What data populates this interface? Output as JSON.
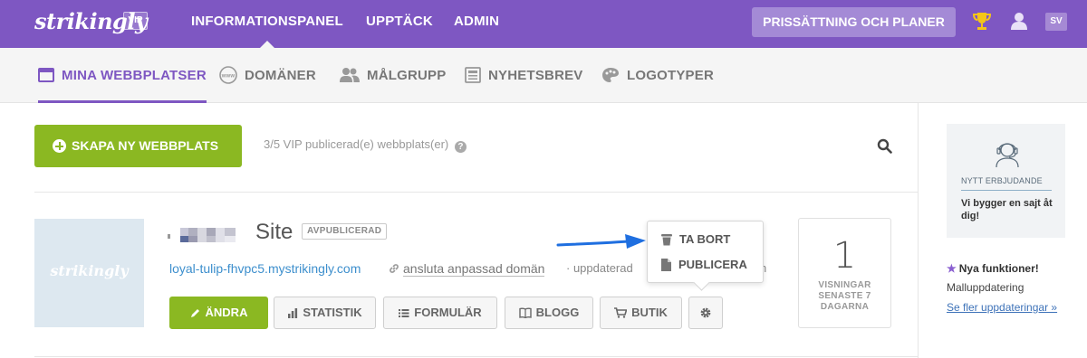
{
  "topbar": {
    "logo": "strikingly",
    "vip_badge": "VIP",
    "nav": [
      "INFORMATIONSPANEL",
      "UPPTÄCK",
      "ADMIN"
    ],
    "pricing_button": "PRISSÄTTNING OCH PLANER",
    "language": "SV",
    "icons": [
      "trophy-icon",
      "user-icon"
    ]
  },
  "subnav": {
    "items": [
      {
        "label": "MINA WEBBPLATSER",
        "icon": "browser-window-icon"
      },
      {
        "label": "DOMÄNER",
        "icon": "www-icon"
      },
      {
        "label": "MÅLGRUPP",
        "icon": "users-icon"
      },
      {
        "label": "NYHETSBREV",
        "icon": "newsletter-icon"
      },
      {
        "label": "LOGOTYPER",
        "icon": "palette-icon"
      }
    ]
  },
  "toolbar": {
    "create_label": "SKAPA NY WEBBPLATS",
    "vip_count": "3/5 VIP publicerad(e) webbplats(er)",
    "help": "?"
  },
  "site": {
    "thumb_logo": "strikingly",
    "name": "Site",
    "status": "AVPUBLICERAD",
    "url": "loyal-tulip-fhvpc5.mystrikingly.com",
    "connect_domain": "ansluta anpassad domän",
    "updated": "· uppdaterad",
    "updated_tail": "h",
    "buttons": {
      "edit": "ÄNDRA",
      "stats": "STATISTIK",
      "forms": "FORMULÄR",
      "blog": "BLOGG",
      "store": "BUTIK"
    },
    "menu": {
      "delete": "TA BORT",
      "publish": "PUBLICERA"
    },
    "views": {
      "count": "1",
      "label": "VISNINGAR SENASTE 7 DAGARNA"
    }
  },
  "sidebar": {
    "offer_label": "NYTT ERBJUDANDE",
    "offer_text": "Vi bygger en sajt åt dig!",
    "news_title": "Nya funktioner!",
    "news_item": "Malluppdatering",
    "news_link": "Se fler uppdateringar »"
  },
  "colors": {
    "brand": "#7e57c2",
    "accent_green": "#8bb822",
    "link": "#3d8fcd",
    "arrow": "#1f6fe0"
  }
}
